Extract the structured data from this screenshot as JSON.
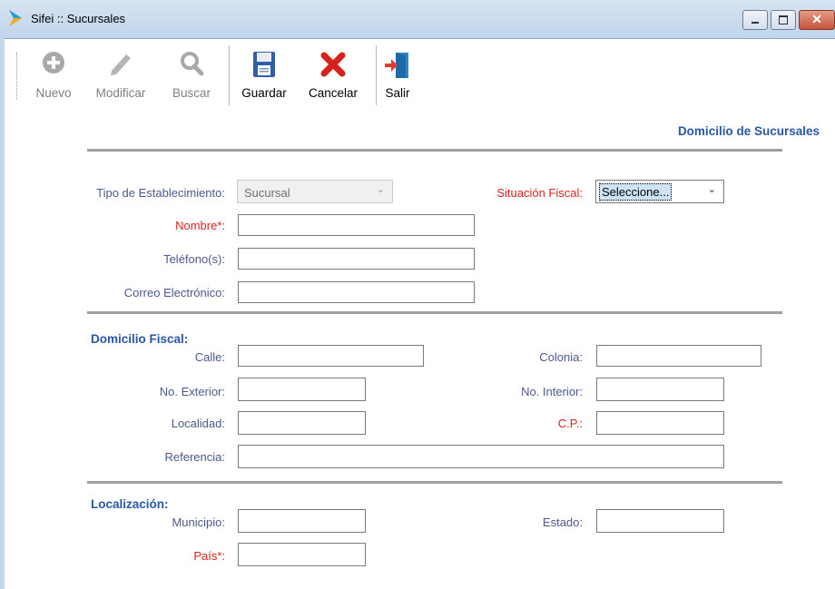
{
  "window": {
    "title": "Sifei :: Sucursales"
  },
  "toolbar": {
    "nuevo": "Nuevo",
    "modificar": "Modificar",
    "buscar": "Buscar",
    "guardar": "Guardar",
    "cancelar": "Cancelar",
    "salir": "Salir"
  },
  "header": {
    "title": "Domicilio de Sucursales"
  },
  "general": {
    "tipo_label": "Tipo de Establecimiento:",
    "tipo_value": "Sucursal",
    "situacion_label": "Situación Fiscal:",
    "situacion_value": "Seleccione...",
    "nombre_label": "Nombre*:",
    "telefono_label": "Teléfono(s):",
    "correo_label": "Correo Electrónico:"
  },
  "domicilio": {
    "section_title": "Domicilio Fiscal:",
    "calle_label": "Calle:",
    "colonia_label": "Colonia:",
    "no_exterior_label": "No. Exterior:",
    "no_interior_label": "No. Interior:",
    "localidad_label": "Localidad:",
    "cp_label": "C.P.:",
    "referencia_label": "Referencia:"
  },
  "localizacion": {
    "section_title": "Localización:",
    "municipio_label": "Municipio:",
    "estado_label": "Estado:",
    "pais_label": "País*:"
  },
  "colors": {
    "accent": "#2a57a8",
    "required": "#e1201d",
    "label": "#4b5a8c"
  },
  "icons": [
    "app-logo-icon",
    "add-icon",
    "edit-icon",
    "search-icon",
    "save-icon",
    "cancel-icon",
    "exit-icon",
    "chevron-down-icon"
  ]
}
